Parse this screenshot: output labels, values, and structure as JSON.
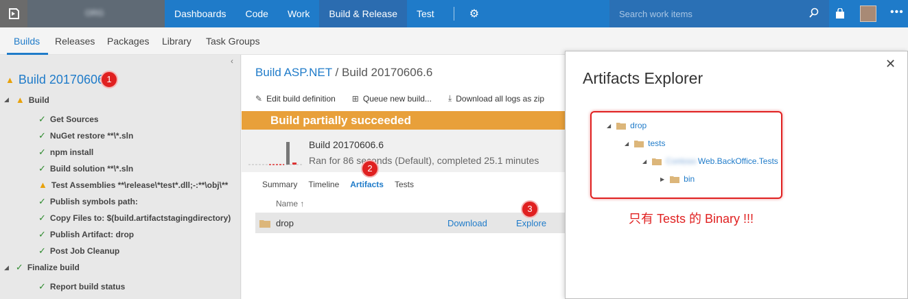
{
  "topbar": {
    "account": "ORG",
    "nav": [
      "Dashboards",
      "Code",
      "Work",
      "Build & Release",
      "Test"
    ],
    "search_placeholder": "Search work items"
  },
  "subnav": [
    "Builds",
    "Releases",
    "Packages",
    "Library",
    "Task Groups"
  ],
  "left": {
    "title": "Build 20170606.",
    "badge": "1",
    "tree": [
      {
        "label": "Build",
        "status": "warning",
        "level": 0
      },
      {
        "label": "Get Sources",
        "status": "success",
        "level": 1
      },
      {
        "label": "NuGet restore **\\*.sln",
        "status": "success",
        "level": 1
      },
      {
        "label": "npm install",
        "status": "success",
        "level": 1
      },
      {
        "label": "Build solution **\\*.sln",
        "status": "success",
        "level": 1
      },
      {
        "label": "Test Assemblies **\\release\\*test*.dll;-:**\\obj\\**",
        "status": "warning",
        "level": 1
      },
      {
        "label": "Publish symbols path:",
        "status": "success",
        "level": 1
      },
      {
        "label": "Copy Files to: $(build.artifactstagingdirectory)",
        "status": "success",
        "level": 1
      },
      {
        "label": "Publish Artifact: drop",
        "status": "success",
        "level": 1
      },
      {
        "label": "Post Job Cleanup",
        "status": "success",
        "level": 1
      },
      {
        "label": "Finalize build",
        "status": "success",
        "level": 0
      },
      {
        "label": "Report build status",
        "status": "success",
        "level": 1
      }
    ]
  },
  "middle": {
    "crumb_link": "Build ASP.NET",
    "crumb_sep": " / ",
    "crumb_current": "Build 20170606.6",
    "toolbar": [
      "Edit build definition",
      "Queue new build...",
      "Download all logs as zip"
    ],
    "banner": "Build partially succeeded",
    "summary_title": "Build 20170606.6",
    "summary_sub": "Ran for 86 seconds (Default), completed 25.1 minutes",
    "tabs": [
      "Summary",
      "Timeline",
      "Artifacts",
      "Tests"
    ],
    "col_name": "Name ↑",
    "artifact": {
      "name": "drop",
      "download": "Download",
      "explore": "Explore"
    },
    "badge2": "2",
    "badge3": "3"
  },
  "dialog": {
    "title": "Artifacts Explorer",
    "tree": [
      {
        "label": "drop",
        "expanded": true
      },
      {
        "label": "tests",
        "expanded": true
      },
      {
        "label_blur": "Contoso",
        "label": "Web.BackOffice.Tests",
        "expanded": true
      },
      {
        "label": "bin",
        "expanded": false
      }
    ],
    "note": "只有 Tests 的 Binary !!!"
  }
}
